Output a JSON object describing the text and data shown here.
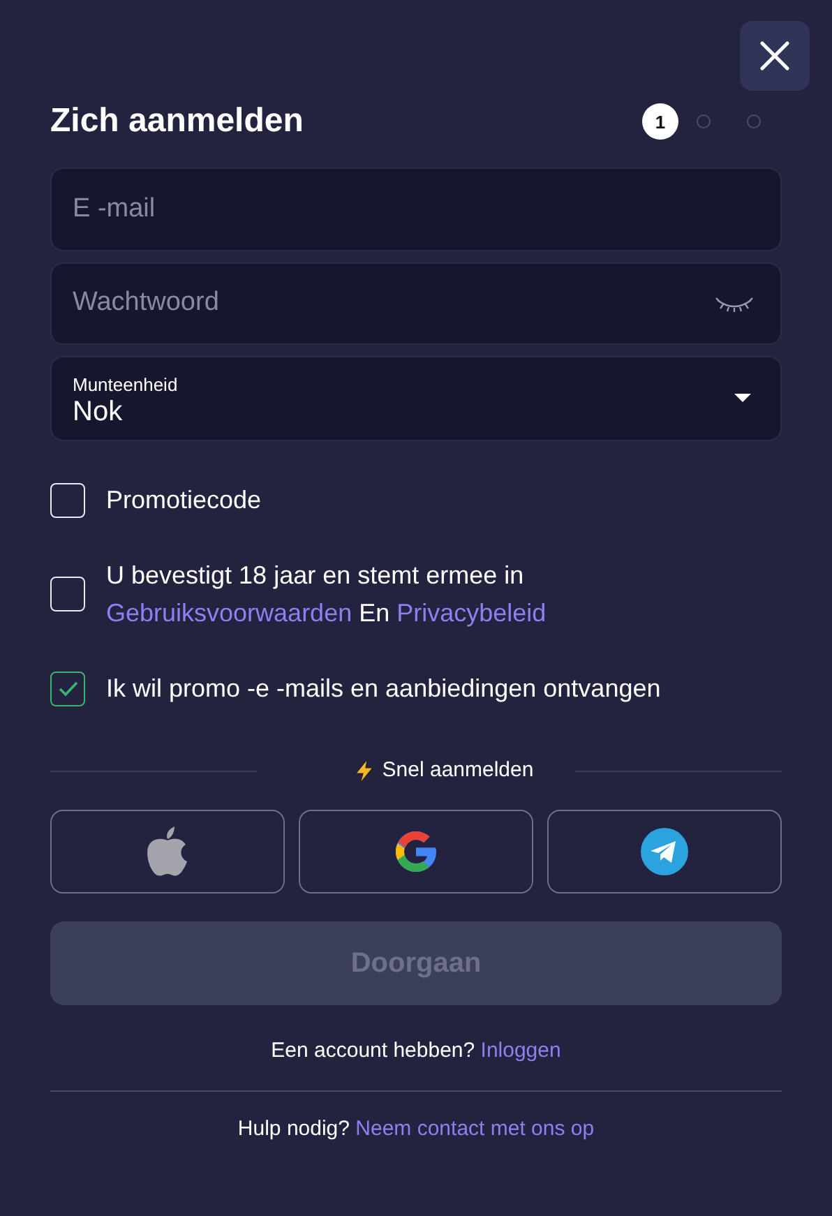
{
  "title": "Zich aanmelden",
  "steps": [
    {
      "label": "1",
      "selected": true
    },
    {
      "selected": false
    },
    {
      "selected": false
    }
  ],
  "email_field": {
    "placeholder": "E -mail"
  },
  "password_field": {
    "placeholder": "Wachtwoord"
  },
  "currency_select": {
    "label": "Munteenheid",
    "value": "Nok"
  },
  "checkboxes": [
    {
      "kind": "plain",
      "label": "Promotiecode",
      "checked": false
    },
    {
      "kind": "consent",
      "text_before": "U bevestigt 18 jaar en stemt ermee in",
      "link_1": "Gebruiksvoorwaarden",
      "text_between": "En",
      "link_2": "Privacybeleid",
      "checked": false
    },
    {
      "kind": "plain",
      "label": "Ik wil promo -e -mails en aanbiedingen ontvangen",
      "checked": true
    }
  ],
  "quick_signup": {
    "label": "Snel aanmelden"
  },
  "social_buttons": [
    {
      "kind": "apple"
    },
    {
      "kind": "google"
    },
    {
      "kind": "telegram"
    }
  ],
  "continue_button": {
    "label": "Doorgaan",
    "disabled": true
  },
  "login_prompt": {
    "text": "Een account hebben?",
    "link": "Inloggen"
  },
  "help": {
    "text": "Hulp nodig?",
    "link": "Neem contact met ons op"
  }
}
